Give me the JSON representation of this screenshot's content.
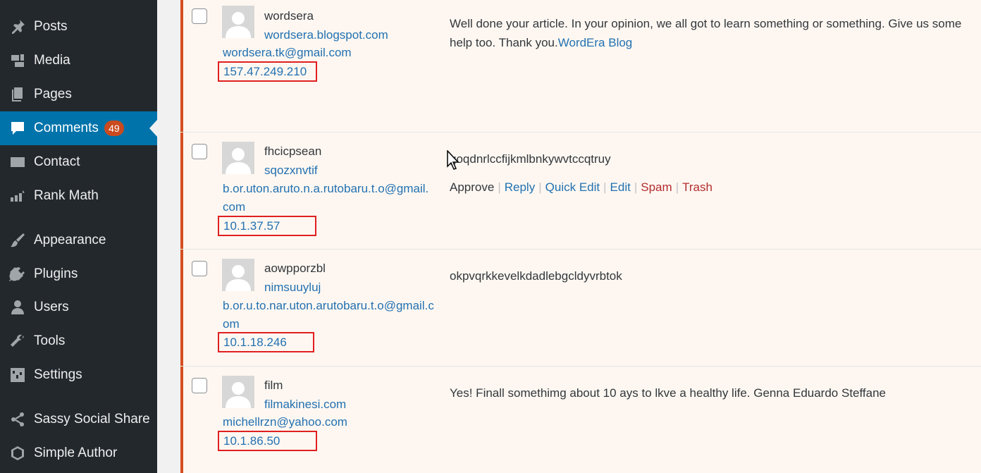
{
  "sidebar": {
    "items": [
      {
        "label": "Posts",
        "icon": "pin-icon"
      },
      {
        "label": "Media",
        "icon": "media-icon"
      },
      {
        "label": "Pages",
        "icon": "pages-icon"
      },
      {
        "label": "Comments",
        "icon": "comment-icon",
        "badge": "49",
        "current": true
      },
      {
        "label": "Contact",
        "icon": "envelope-icon"
      },
      {
        "label": "Rank Math",
        "icon": "chart-icon"
      },
      {
        "label": "Appearance",
        "icon": "brush-icon"
      },
      {
        "label": "Plugins",
        "icon": "plug-icon"
      },
      {
        "label": "Users",
        "icon": "user-icon"
      },
      {
        "label": "Tools",
        "icon": "wrench-icon"
      },
      {
        "label": "Settings",
        "icon": "settings-icon"
      },
      {
        "label": "Sassy Social Share",
        "icon": "share-icon"
      },
      {
        "label": "Simple Author",
        "icon": "author-icon"
      }
    ]
  },
  "comments": [
    {
      "author": "wordsera",
      "url": "wordsera.blogspot.com",
      "email": "wordsera.tk@gmail.com",
      "ip": "157.47.249.210",
      "text": "Well done your article. In your opinion, we all got to learn something or something. Give us some help too. Thank you.",
      "link_text": "WordEra Blog"
    },
    {
      "author": "fhcicpsean",
      "url": "sqozxnvtif",
      "email": "b.or.uton.aruto.n.a.rutobaru.t.o@gmail.com",
      "ip": "10.1.37.57",
      "text": "goqdnrlccfijkmlbnkywvtccqtruy",
      "actions": {
        "approve": "Approve",
        "reply": "Reply",
        "quick_edit": "Quick Edit",
        "edit": "Edit",
        "spam": "Spam",
        "trash": "Trash",
        "separator": "|"
      }
    },
    {
      "author": "aowpporzbl",
      "url": "nimsuuyluj",
      "email": "b.or.u.to.nar.uton.arutobaru.t.o@gmail.com",
      "ip": "10.1.18.246",
      "text": "okpvqrkkevelkdadlebgcldyvrbtok"
    },
    {
      "author": "film",
      "url": "filmakinesi.com",
      "email": "michellrzn@yahoo.com",
      "ip": "10.1.86.50",
      "text": "Yes! Finall somethimg about 10 ays to lkve a healthy life. Genna Eduardo Steffane"
    }
  ],
  "colors": {
    "sidebar_bg": "#23282d",
    "current_menu": "#0073aa",
    "badge": "#ca4a1f",
    "link": "#2271b1",
    "unapproved_border": "#d54e21",
    "highlight_box": "#e02020"
  }
}
